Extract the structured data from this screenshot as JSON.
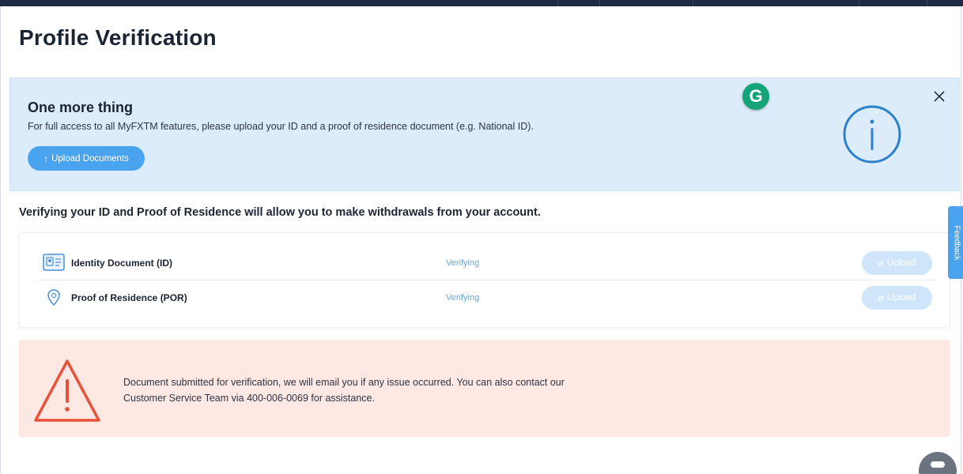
{
  "page": {
    "title": "Profile Verification"
  },
  "info_banner": {
    "heading": "One more thing",
    "text": "For full access to all MyFXTM features, please upload your ID and a proof of residence document (e.g. National ID).",
    "button_label": "Upload Documents",
    "close_icon": "close-icon",
    "info_icon": "info-icon"
  },
  "grammarly": {
    "letter": "G"
  },
  "verification": {
    "note": "Verifying your ID and Proof of Residence will allow you to make withdrawals from your account.",
    "documents": [
      {
        "label": "Identity Document (ID)",
        "status": "Verifying",
        "upload_label": "Upload",
        "icon": "id-card-icon"
      },
      {
        "label": "Proof of Residence (POR)",
        "status": "Verifying",
        "upload_label": "Upload",
        "icon": "location-pin-icon"
      }
    ]
  },
  "alert": {
    "text": "Document submitted for verification, we will email you if any issue occurred. You can also contact our Customer Service Team via 400-006-0069 for assistance.",
    "icon": "warning-icon"
  },
  "feedback": {
    "label": "Feedback"
  },
  "colors": {
    "accent": "#4aa3ee",
    "info_bg": "#dcecfb",
    "alert_bg": "#fde8e3",
    "warning_red": "#e8523a",
    "status_blue": "#6aa7da"
  }
}
